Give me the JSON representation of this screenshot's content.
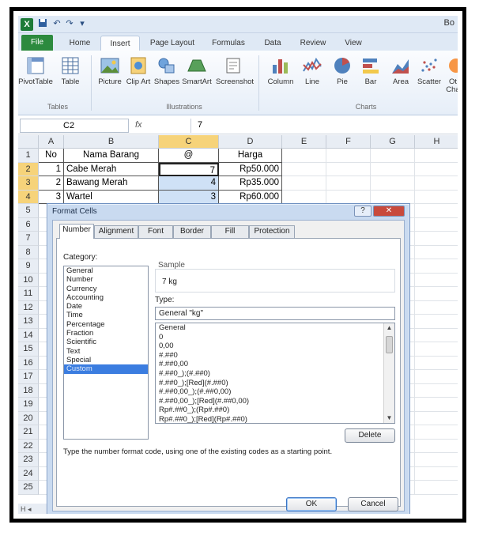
{
  "app": {
    "title": "Bo",
    "undo_glyph": "↶",
    "redo_glyph": "↷",
    "menu_glyph": "▾"
  },
  "ribbon": {
    "tabs": [
      "File",
      "Home",
      "Insert",
      "Page Layout",
      "Formulas",
      "Data",
      "Review",
      "View"
    ],
    "active_tab": "Insert",
    "buttons": [
      {
        "label": "PivotTable",
        "icon": "pivottable-icon"
      },
      {
        "label": "Table",
        "icon": "table-icon"
      },
      {
        "label": "Picture",
        "icon": "picture-icon"
      },
      {
        "label": "Clip Art",
        "icon": "clipart-icon"
      },
      {
        "label": "Shapes",
        "icon": "shapes-icon"
      },
      {
        "label": "SmartArt",
        "icon": "smartart-icon"
      },
      {
        "label": "Screenshot",
        "icon": "screenshot-icon"
      },
      {
        "label": "Column",
        "icon": "column-chart-icon"
      },
      {
        "label": "Line",
        "icon": "line-chart-icon"
      },
      {
        "label": "Pie",
        "icon": "pie-chart-icon"
      },
      {
        "label": "Bar",
        "icon": "bar-chart-icon"
      },
      {
        "label": "Area",
        "icon": "area-chart-icon"
      },
      {
        "label": "Scatter",
        "icon": "scatter-chart-icon"
      },
      {
        "label": "Ot Cha",
        "icon": "other-charts-icon"
      }
    ],
    "groups": [
      "Tables",
      "Illustrations",
      "Charts"
    ]
  },
  "formula_bar": {
    "name_box": "C2",
    "fx": "fx",
    "value": "7"
  },
  "sheet": {
    "columns": [
      "A",
      "B",
      "C",
      "D",
      "E",
      "F",
      "G",
      "H"
    ],
    "selected_column": "C",
    "rows": [
      "1",
      "2",
      "3",
      "4",
      "5",
      "6",
      "7",
      "8",
      "9",
      "10",
      "11",
      "12",
      "13",
      "14",
      "15",
      "16",
      "17",
      "18",
      "19",
      "20",
      "21",
      "22",
      "23",
      "24",
      "25"
    ],
    "selected_rows": [
      "2",
      "3",
      "4"
    ],
    "header": [
      "No",
      "Nama Barang",
      "@",
      "Harga"
    ],
    "data": [
      [
        "1",
        "Cabe Merah",
        "7",
        "Rp50.000"
      ],
      [
        "2",
        "Bawang Merah",
        "4",
        "Rp35.000"
      ],
      [
        "3",
        "Wartel",
        "3",
        "Rp60.000"
      ]
    ],
    "sheet_nav": "H ◂"
  },
  "dialog": {
    "title": "Format Cells",
    "help": "?",
    "close": "✕",
    "tabs": [
      "Number",
      "Alignment",
      "Font",
      "Border",
      "Fill",
      "Protection"
    ],
    "active_tab": "Number",
    "category_label": "Category:",
    "categories": [
      "General",
      "Number",
      "Currency",
      "Accounting",
      "Date",
      "Time",
      "Percentage",
      "Fraction",
      "Scientific",
      "Text",
      "Special",
      "Custom"
    ],
    "selected_category": "Custom",
    "sample_label": "Sample",
    "sample_value": "7 kg",
    "type_label": "Type:",
    "type_value": "General \"kg\"",
    "formats": [
      "General",
      "0",
      "0,00",
      "#.##0",
      "#.##0,00",
      "#.##0_);(#.##0)",
      "#.##0_);[Red](#.##0)",
      "#.##0,00_);(#.##0,00)",
      "#.##0,00_);[Red](#.##0,00)",
      "Rp#.##0_);(Rp#.##0)",
      "Rp#.##0_);[Red](Rp#.##0)"
    ],
    "delete_label": "Delete",
    "hint": "Type the number format code, using one of the existing codes as a starting point.",
    "ok_label": "OK",
    "cancel_label": "Cancel"
  }
}
